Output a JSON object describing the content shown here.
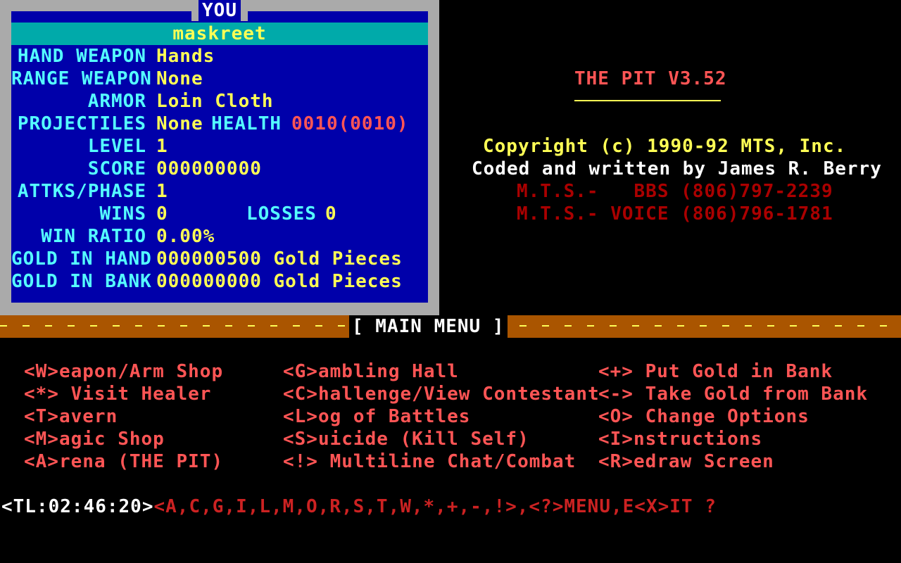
{
  "panel": {
    "title": "YOU",
    "player_name": "maskreet",
    "rows": [
      {
        "label": "HAND WEAPON",
        "value": "Hands"
      },
      {
        "label": "RANGE WEAPON",
        "value": "None"
      },
      {
        "label": "ARMOR",
        "value": "Loin Cloth"
      },
      {
        "label": "PROJECTILES",
        "value": "None"
      },
      {
        "label": "LEVEL",
        "value": "1"
      },
      {
        "label": "SCORE",
        "value": "000000000"
      },
      {
        "label": "ATTKS/PHASE",
        "value": "1"
      },
      {
        "label": "WINS",
        "value": "0"
      },
      {
        "label": "WIN RATIO",
        "value": "0.00%"
      },
      {
        "label": "GOLD IN HAND",
        "value": "000000500 Gold Pieces"
      },
      {
        "label": "GOLD IN BANK",
        "value": "000000000 Gold Pieces"
      }
    ],
    "health_label": "HEALTH",
    "health_value": "0010(0010)",
    "losses_label": "LOSSES",
    "losses_value": "0"
  },
  "info": {
    "game_title": "THE PIT V3.52",
    "copyright": "Copyright (c) 1990-92 MTS, Inc.",
    "credits": "Coded and written by James R. Berry",
    "bbs_line": "M.T.S.-   BBS (806)797-2239",
    "voice_line": "M.T.S.- VOICE (806)796-1781"
  },
  "menu": {
    "title": "[ MAIN MENU ]",
    "col1": [
      "<W>eapon/Arm Shop",
      "<*> Visit Healer",
      "<T>avern",
      "<M>agic Shop",
      "<A>rena (THE PIT)"
    ],
    "col2": [
      "<G>ambling Hall",
      "<C>hallenge/View Contestant",
      "<L>og of Battles",
      "<S>uicide (Kill Self)",
      "<!> Multiline Chat/Combat"
    ],
    "col3": [
      "<+> Put Gold in Bank",
      "<-> Take Gold from Bank",
      "<O> Change Options",
      "<I>nstructions",
      "<R>edraw Screen"
    ]
  },
  "prompt": {
    "time_left": "<TL:02:46:20>",
    "options": "<A,C,G,I,L,M,O,R,S,T,W,*,+,-,!>,<?>MENU,E<X>IT ?"
  },
  "colors": {
    "panel_blue": "#0000aa",
    "panel_border": "#aaaaaa",
    "name_bar": "#00aaaa",
    "label_cyan": "#55ffff",
    "value_yellow": "#ffff55",
    "menu_red": "#ff5555",
    "menu_bar_brown": "#aa5500"
  }
}
